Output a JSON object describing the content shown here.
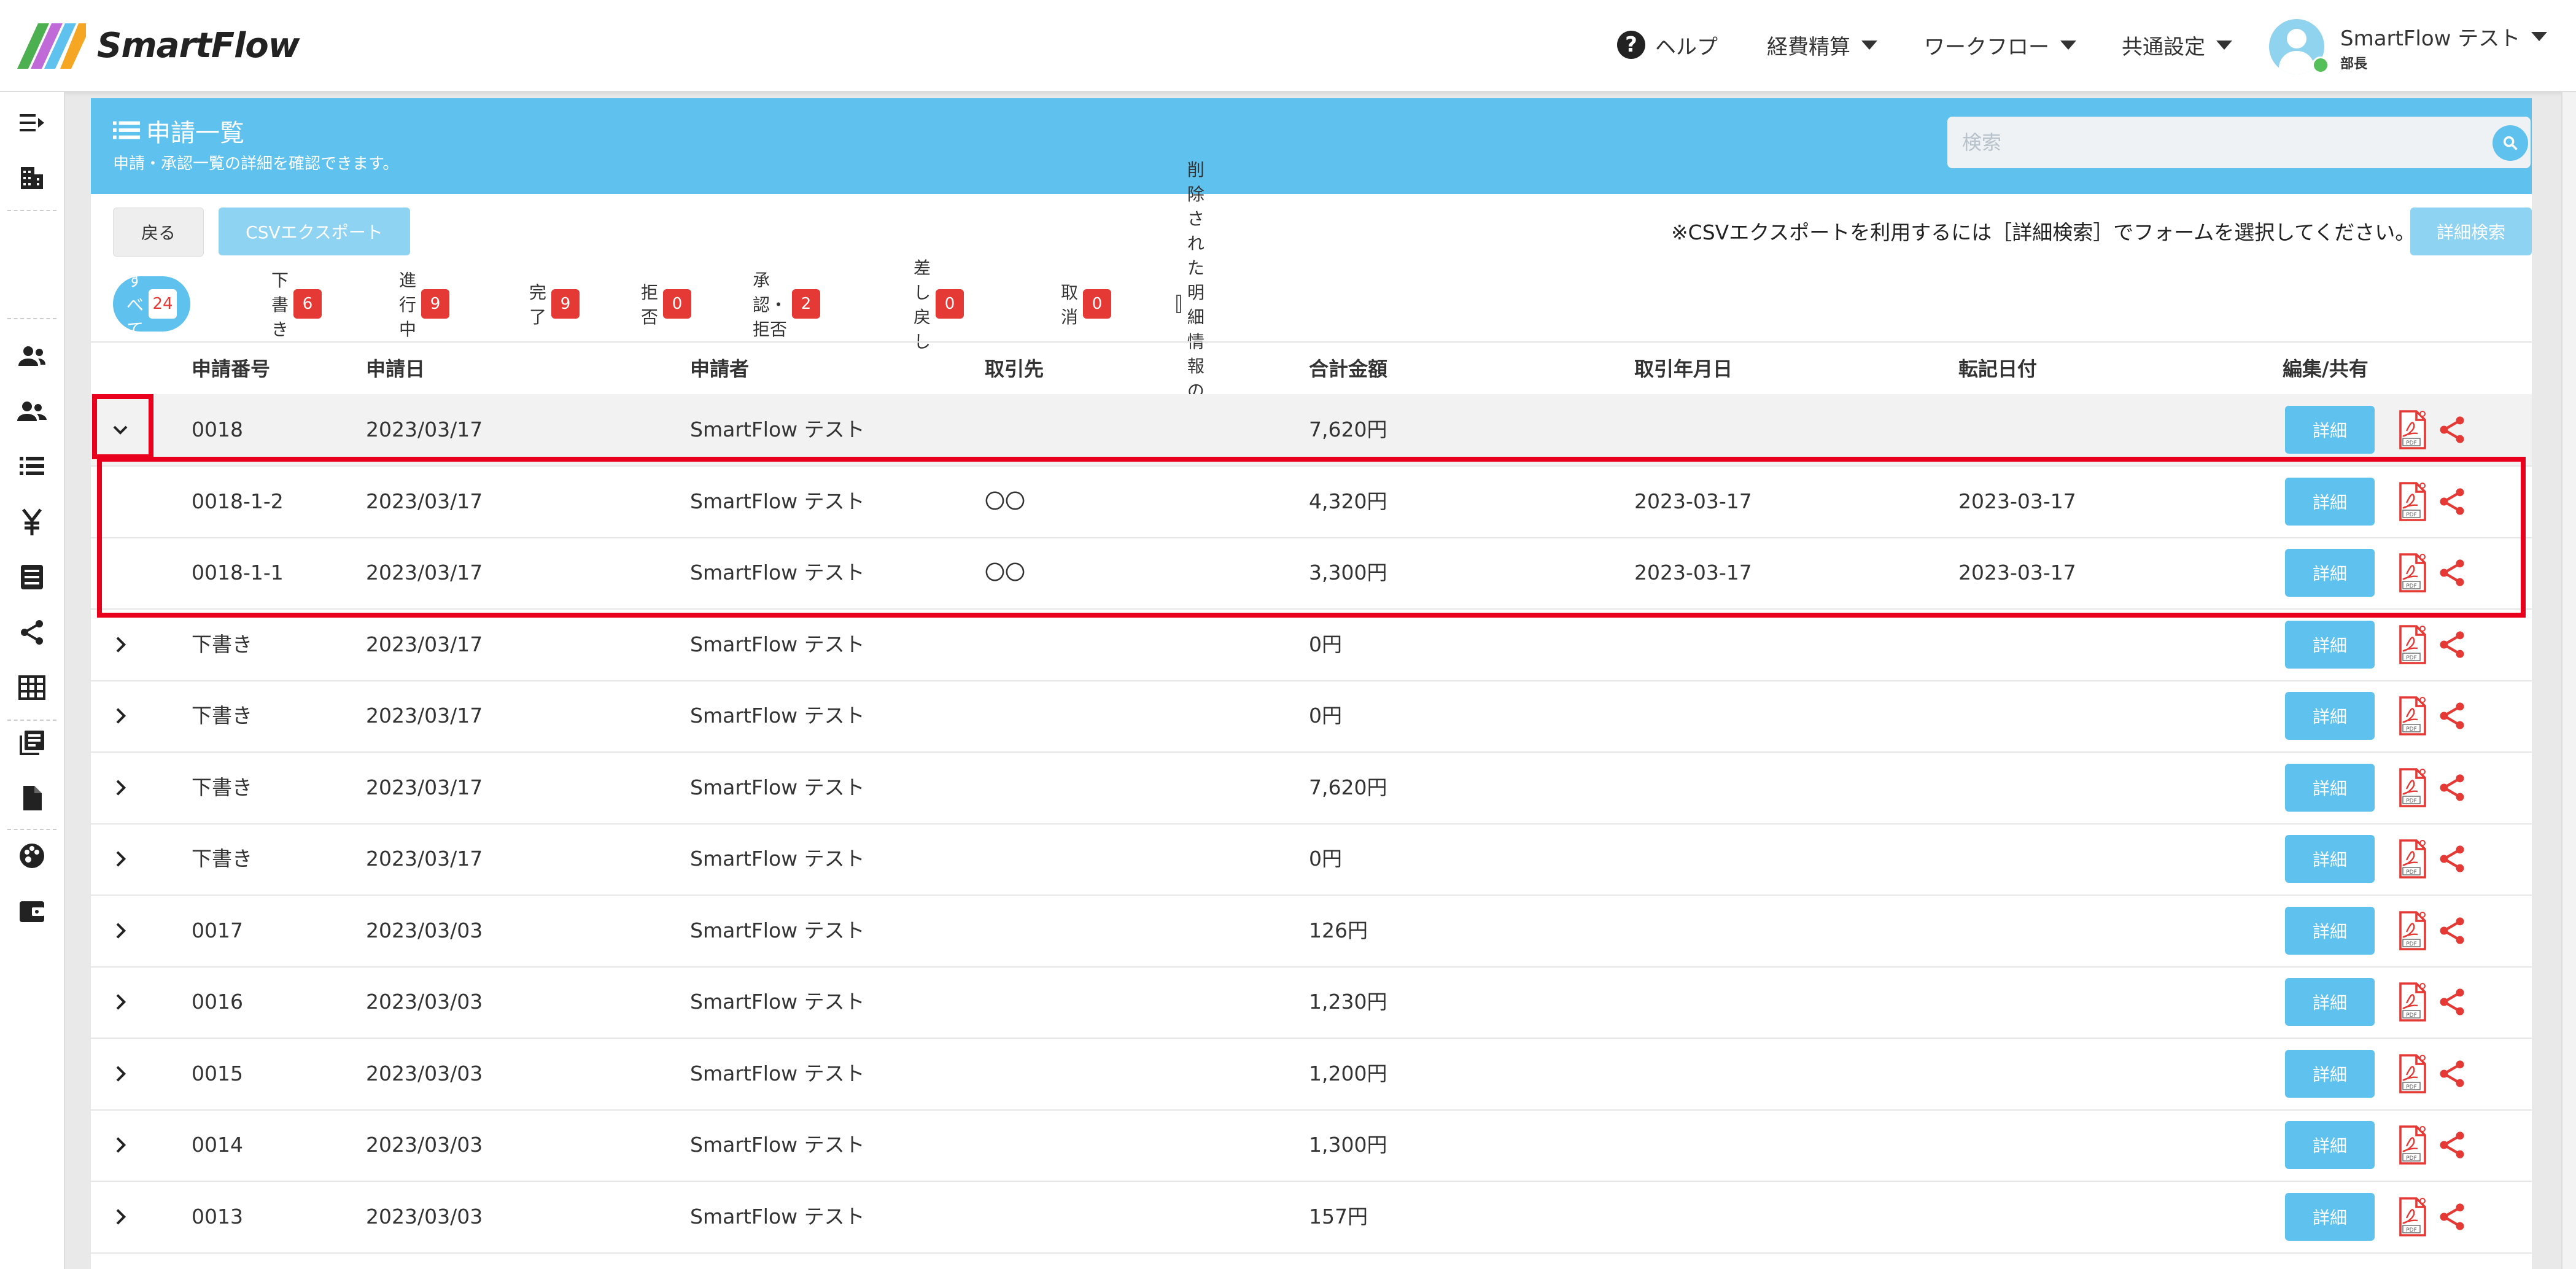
{
  "header": {
    "logo_text": "SmartFlow",
    "nav": [
      {
        "label": "ヘルプ"
      },
      {
        "label": "経費精算"
      },
      {
        "label": "ワークフロー"
      },
      {
        "label": "共通設定"
      }
    ],
    "user": {
      "name": "SmartFlow テスト",
      "role": "部長"
    }
  },
  "rail": {
    "icons": [
      "collapse-menu-icon",
      "building-icon",
      "users-icon",
      "users-group-icon",
      "list-icon",
      "yen-icon",
      "ledger-icon",
      "share-icon",
      "table-icon",
      "library-icon",
      "document-icon",
      "palette-icon",
      "wallet-icon"
    ]
  },
  "panel": {
    "title": "申請一覧",
    "subtitle": "申請・承認一覧の詳細を確認できます。",
    "search_placeholder": "検索",
    "back_button": "戻る",
    "csv_button": "CSVエクスポート",
    "notice": "※CSVエクスポートを利用するには［詳細検索］でフォームを選択してください。",
    "advanced_search_button": "詳細検索"
  },
  "filters": [
    {
      "label": "すべて",
      "count": "24",
      "active": true
    },
    {
      "label": "下書き",
      "count": "6"
    },
    {
      "label": "進行中",
      "count": "9"
    },
    {
      "label": "完了",
      "count": "9"
    },
    {
      "label": "拒否",
      "count": "0"
    },
    {
      "label": "承認・拒否",
      "count": "2"
    },
    {
      "label": "差し戻し",
      "count": "0"
    },
    {
      "label": "取消",
      "count": "0"
    }
  ],
  "show_deleted_label": "削除された明細情報の表示",
  "table": {
    "columns": [
      "申請番号",
      "申請日",
      "申請者",
      "取引先",
      "合計金額",
      "取引年月日",
      "転記日付",
      "編集/共有"
    ],
    "detail_label": "詳細",
    "rows": [
      {
        "no": "0018",
        "date": "2023/03/17",
        "applicant": "SmartFlow テスト",
        "partner": "",
        "amount": "7,620円",
        "txn_date": "",
        "post_date": "",
        "type": "parent"
      },
      {
        "no": "0018-1-2",
        "date": "2023/03/17",
        "applicant": "SmartFlow テスト",
        "partner": "〇〇",
        "amount": "4,320円",
        "txn_date": "2023-03-17",
        "post_date": "2023-03-17",
        "type": "child"
      },
      {
        "no": "0018-1-1",
        "date": "2023/03/17",
        "applicant": "SmartFlow テスト",
        "partner": "〇〇",
        "amount": "3,300円",
        "txn_date": "2023-03-17",
        "post_date": "2023-03-17",
        "type": "child"
      },
      {
        "no": "下書き",
        "date": "2023/03/17",
        "applicant": "SmartFlow テスト",
        "partner": "",
        "amount": "0円",
        "txn_date": "",
        "post_date": "",
        "type": "collapsed"
      },
      {
        "no": "下書き",
        "date": "2023/03/17",
        "applicant": "SmartFlow テスト",
        "partner": "",
        "amount": "0円",
        "txn_date": "",
        "post_date": "",
        "type": "collapsed"
      },
      {
        "no": "下書き",
        "date": "2023/03/17",
        "applicant": "SmartFlow テスト",
        "partner": "",
        "amount": "7,620円",
        "txn_date": "",
        "post_date": "",
        "type": "collapsed"
      },
      {
        "no": "下書き",
        "date": "2023/03/17",
        "applicant": "SmartFlow テスト",
        "partner": "",
        "amount": "0円",
        "txn_date": "",
        "post_date": "",
        "type": "collapsed"
      },
      {
        "no": "0017",
        "date": "2023/03/03",
        "applicant": "SmartFlow テスト",
        "partner": "",
        "amount": "126円",
        "txn_date": "",
        "post_date": "",
        "type": "collapsed"
      },
      {
        "no": "0016",
        "date": "2023/03/03",
        "applicant": "SmartFlow テスト",
        "partner": "",
        "amount": "1,230円",
        "txn_date": "",
        "post_date": "",
        "type": "collapsed"
      },
      {
        "no": "0015",
        "date": "2023/03/03",
        "applicant": "SmartFlow テスト",
        "partner": "",
        "amount": "1,200円",
        "txn_date": "",
        "post_date": "",
        "type": "collapsed"
      },
      {
        "no": "0014",
        "date": "2023/03/03",
        "applicant": "SmartFlow テスト",
        "partner": "",
        "amount": "1,300円",
        "txn_date": "",
        "post_date": "",
        "type": "collapsed"
      },
      {
        "no": "0013",
        "date": "2023/03/03",
        "applicant": "SmartFlow テスト",
        "partner": "",
        "amount": "157円",
        "txn_date": "",
        "post_date": "",
        "type": "collapsed"
      }
    ]
  },
  "colors": {
    "accent": "#5fc2ee",
    "badge": "#e53935",
    "highlight": "#e8001c"
  }
}
